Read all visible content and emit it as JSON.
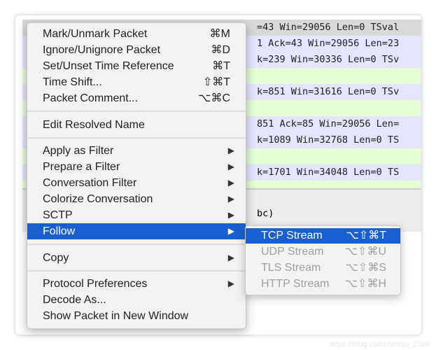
{
  "packet_rows": [
    {
      "text": "=43 Win=29056 Len=0 TSval",
      "color": "#d9d9d9"
    },
    {
      "text": "1 Ack=43 Win=29056 Len=23",
      "color": "#e4e4fc"
    },
    {
      "text": "k=239 Win=30336 Len=0 TSv",
      "color": "#e4e4fc"
    },
    {
      "text": "",
      "color": "#e4fcd4"
    },
    {
      "text": "k=851 Win=31616 Len=0 TSv",
      "color": "#e4e4fc"
    },
    {
      "text": "",
      "color": "#e4fcd4"
    },
    {
      "text": "851 Ack=85 Win=29056 Len=",
      "color": "#e4e4fc"
    },
    {
      "text": "k=1089 Win=32768 Len=0 TS",
      "color": "#e4e4fc"
    },
    {
      "text": "",
      "color": "#e4fcd4"
    },
    {
      "text": "k=1701 Win=34048 Len=0 TS",
      "color": "#e4e4fc"
    },
    {
      "text": "",
      "color": "#e4fcd4"
    }
  ],
  "detail": {
    "text": "bc)"
  },
  "menu": {
    "items": [
      {
        "label": "Mark/Unmark Packet",
        "shortcut": "⌘M"
      },
      {
        "label": "Ignore/Unignore Packet",
        "shortcut": "⌘D"
      },
      {
        "label": "Set/Unset Time Reference",
        "shortcut": "⌘T"
      },
      {
        "label": "Time Shift...",
        "shortcut": "⇧⌘T"
      },
      {
        "label": "Packet Comment...",
        "shortcut": "⌥⌘C"
      },
      {
        "label": "Edit Resolved Name"
      },
      {
        "label": "Apply as Filter",
        "arrow": "▶"
      },
      {
        "label": "Prepare a Filter",
        "arrow": "▶"
      },
      {
        "label": "Conversation Filter",
        "arrow": "▶"
      },
      {
        "label": "Colorize Conversation",
        "arrow": "▶"
      },
      {
        "label": "SCTP",
        "arrow": "▶"
      },
      {
        "label": "Follow",
        "arrow": "▶"
      },
      {
        "label": "Copy",
        "arrow": "▶"
      },
      {
        "label": "Protocol Preferences",
        "arrow": "▶"
      },
      {
        "label": "Decode As..."
      },
      {
        "label": "Show Packet in New Window"
      }
    ]
  },
  "submenu": {
    "items": [
      {
        "label": "TCP Stream",
        "shortcut": "⌥⇧⌘T"
      },
      {
        "label": "UDP Stream",
        "shortcut": "⌥⇧⌘U"
      },
      {
        "label": "TLS Stream",
        "shortcut": "⌥⇧⌘S"
      },
      {
        "label": "HTTP Stream",
        "shortcut": "⌥⇧⌘H"
      }
    ]
  },
  "watermark": "https://blog.csdn.net/qq_2386"
}
